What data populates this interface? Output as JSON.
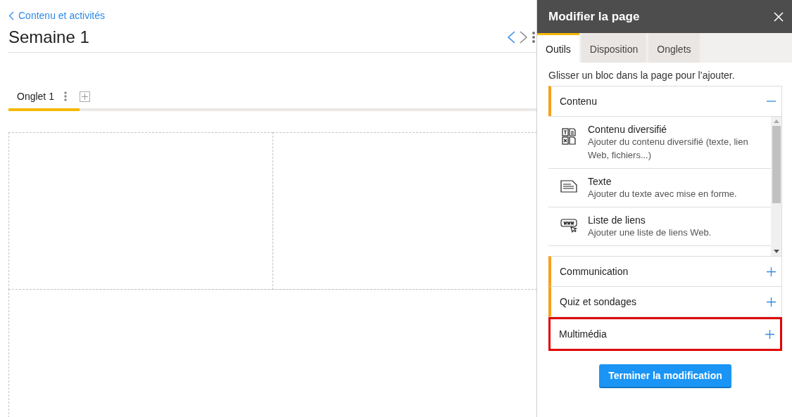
{
  "breadcrumb": "Contenu et activités",
  "page_title": "Semaine 1",
  "page_tabs": [
    {
      "label": "Onglet 1",
      "selected": true
    }
  ],
  "panel": {
    "title": "Modifier la page",
    "tabs": [
      {
        "label": "Outils",
        "selected": true
      },
      {
        "label": "Disposition",
        "selected": false
      },
      {
        "label": "Onglets",
        "selected": false
      }
    ],
    "hint": "Glisser un bloc dans la page pour l’ajouter.",
    "sections": [
      {
        "title": "Contenu",
        "expanded": true,
        "highlighted": false,
        "items": [
          {
            "kind": "mixed",
            "title": "Contenu diversifié",
            "description": "Ajouter du contenu diversifié (texte, lien Web, fichiers...)"
          },
          {
            "kind": "text",
            "title": "Texte",
            "description": "Ajouter du texte avec mise en forme."
          },
          {
            "kind": "links",
            "title": "Liste de liens",
            "description": "Ajouter une liste de liens Web."
          }
        ]
      },
      {
        "title": "Communication",
        "expanded": false,
        "highlighted": false
      },
      {
        "title": "Quiz et sondages",
        "expanded": false,
        "highlighted": false
      },
      {
        "title": "Multimédia",
        "expanded": false,
        "highlighted": true
      }
    ],
    "finish_button": "Terminer la modification"
  }
}
